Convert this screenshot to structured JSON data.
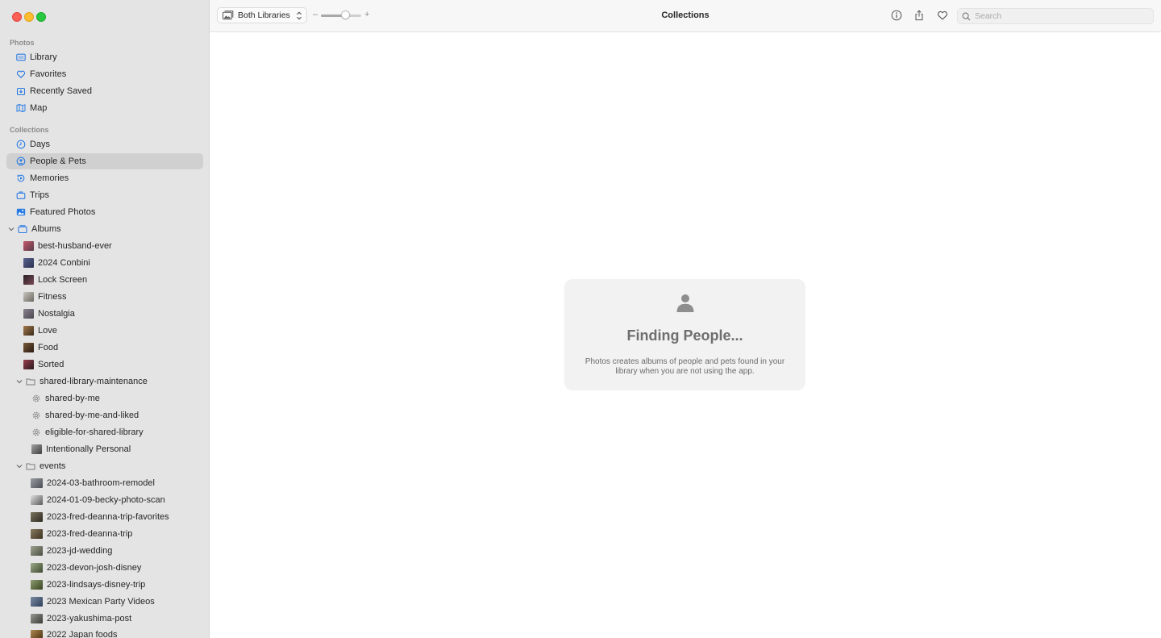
{
  "window": {
    "title": "Collections",
    "traffic_lights": [
      "close",
      "minimize",
      "maximize"
    ]
  },
  "toolbar": {
    "library_picker": "Both Libraries",
    "zoom_minus": "–",
    "zoom_plus": "+",
    "zoom_level": 0.6,
    "search_placeholder": "Search",
    "info_icon": "info-icon",
    "share_icon": "share-icon",
    "favorite_icon": "heart-icon"
  },
  "sidebar": {
    "photos_header": "Photos",
    "photos_items": [
      {
        "label": "Library",
        "icon": "library-icon"
      },
      {
        "label": "Favorites",
        "icon": "heart-icon"
      },
      {
        "label": "Recently Saved",
        "icon": "recently-saved-icon"
      },
      {
        "label": "Map",
        "icon": "map-icon"
      }
    ],
    "collections_header": "Collections",
    "collections_items": [
      {
        "label": "Days",
        "icon": "clock-icon"
      },
      {
        "label": "People & Pets",
        "icon": "person-circle-icon",
        "selected": true
      },
      {
        "label": "Memories",
        "icon": "memories-icon"
      },
      {
        "label": "Trips",
        "icon": "suitcase-icon"
      },
      {
        "label": "Featured Photos",
        "icon": "featured-photos-icon"
      }
    ],
    "albums": {
      "label": "Albums",
      "icon": "albums-icon",
      "items": [
        {
          "label": "best-husband-ever",
          "thumb": "#b54a57"
        },
        {
          "label": "2024 Conbini",
          "thumb": "#4a5478"
        },
        {
          "label": "Lock Screen",
          "thumb": "#3b2a33"
        },
        {
          "label": "Fitness",
          "thumb": "#9a9890"
        },
        {
          "label": "Nostalgia",
          "thumb": "#6f6a72"
        },
        {
          "label": "Love",
          "thumb": "#7a5a3b"
        },
        {
          "label": "Food",
          "thumb": "#5a3a2a"
        },
        {
          "label": "Sorted",
          "thumb": "#7a2f3b"
        }
      ],
      "folders": [
        {
          "label": "shared-library-maintenance",
          "items": [
            {
              "label": "shared-by-me",
              "icon": "gear-icon"
            },
            {
              "label": "shared-by-me-and-liked",
              "icon": "gear-icon"
            },
            {
              "label": "eligible-for-shared-library",
              "icon": "gear-icon"
            },
            {
              "label": "Intentionally Personal",
              "icon": "photo-icon",
              "thumb": "#6b6b6b"
            }
          ]
        },
        {
          "label": "events",
          "items": [
            {
              "label": "2024-03-bathroom-remodel",
              "thumb": "#777b80"
            },
            {
              "label": "2024-01-09-becky-photo-scan",
              "thumb": "#8c8c8c"
            },
            {
              "label": "2023-fred-deanna-trip-favorites",
              "thumb": "#5e5a4a"
            },
            {
              "label": "2023-fred-deanna-trip",
              "thumb": "#6a604c"
            },
            {
              "label": "2023-jd-wedding",
              "thumb": "#7b7f70"
            },
            {
              "label": "2023-devon-josh-disney",
              "thumb": "#7a8a6a"
            },
            {
              "label": "2023-lindsays-disney-trip",
              "thumb": "#6e7d5a"
            },
            {
              "label": "2023 Mexican Party Videos",
              "thumb": "#5d6d86"
            },
            {
              "label": "2023-yakushima-post",
              "thumb": "#6b6b66"
            },
            {
              "label": "2022 Japan foods",
              "thumb": "#8a6a40"
            }
          ]
        }
      ]
    }
  },
  "main": {
    "status_card": {
      "icon": "person-icon",
      "title": "Finding People...",
      "description": "Photos creates albums of people and pets found in your library when you are not using the app."
    }
  }
}
